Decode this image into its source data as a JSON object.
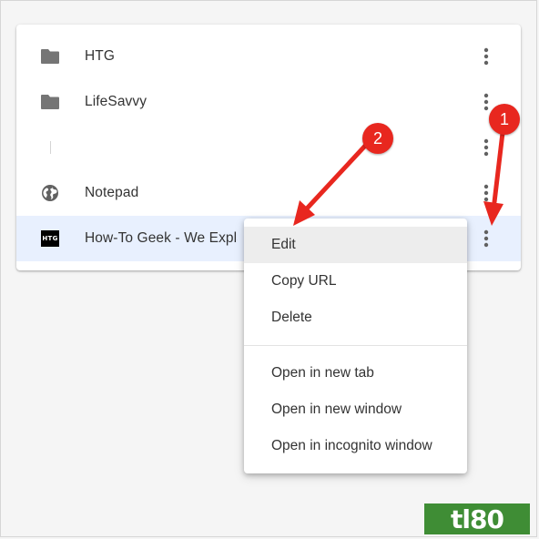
{
  "bookmarks": [
    {
      "icon": "folder-icon",
      "label": "HTG"
    },
    {
      "icon": "folder-icon",
      "label": "LifeSavvy"
    },
    {
      "icon": "blank-page-icon",
      "label": ""
    },
    {
      "icon": "globe-icon",
      "label": "Notepad"
    },
    {
      "icon": "htg-favicon",
      "favicon_text": "HTG",
      "label": "How-To Geek - We Explain Technology"
    }
  ],
  "context_menu": {
    "items": [
      "Edit",
      "Copy URL",
      "Delete"
    ],
    "open_items": [
      "Open in new tab",
      "Open in new window",
      "Open in incognito window"
    ]
  },
  "annotations": {
    "step1": "1",
    "step2": "2",
    "arrow_color": "#e8271f"
  },
  "colors": {
    "selected_row": "#e8f0fe",
    "icon_gray": "#757575",
    "watermark_green": "#3f8d35"
  },
  "watermark": {
    "text": "tl80"
  }
}
